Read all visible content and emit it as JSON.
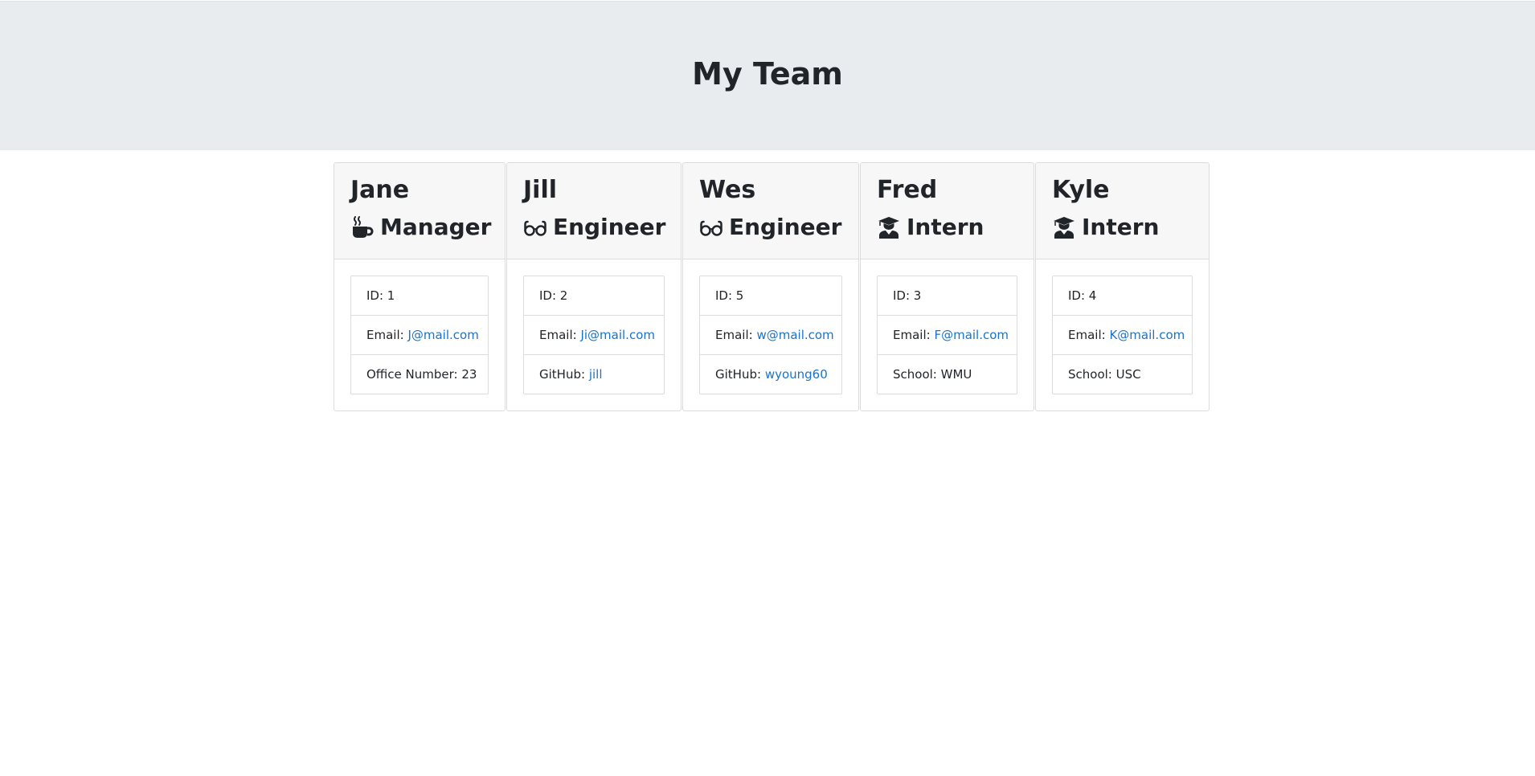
{
  "header": {
    "title": "My Team"
  },
  "team": [
    {
      "name": "Jane",
      "role": "Manager",
      "icon": "coffee-mug-icon",
      "id_label": "ID: 1",
      "email_label": "Email: ",
      "email": "J@mail.com",
      "extra_label": "Office Number: 23",
      "extra_link": ""
    },
    {
      "name": "Jill",
      "role": "Engineer",
      "icon": "glasses-icon",
      "id_label": "ID: 2",
      "email_label": "Email: ",
      "email": "Ji@mail.com",
      "extra_label": "GitHub: ",
      "extra_link": "jill"
    },
    {
      "name": "Wes",
      "role": "Engineer",
      "icon": "glasses-icon",
      "id_label": "ID: 5",
      "email_label": "Email: ",
      "email": "w@mail.com",
      "extra_label": "GitHub: ",
      "extra_link": "wyoung60"
    },
    {
      "name": "Fred",
      "role": "Intern",
      "icon": "graduate-icon",
      "id_label": "ID: 3",
      "email_label": "Email: ",
      "email": "F@mail.com",
      "extra_label": "School: WMU",
      "extra_link": ""
    },
    {
      "name": "Kyle",
      "role": "Intern",
      "icon": "graduate-icon",
      "id_label": "ID: 4",
      "email_label": "Email: ",
      "email": "K@mail.com",
      "extra_label": "School: USC",
      "extra_link": ""
    }
  ],
  "colors": {
    "header_bg": "#e9ecef",
    "card_header_bg": "#f7f7f7",
    "link": "#1a73c8",
    "text": "#212529"
  }
}
